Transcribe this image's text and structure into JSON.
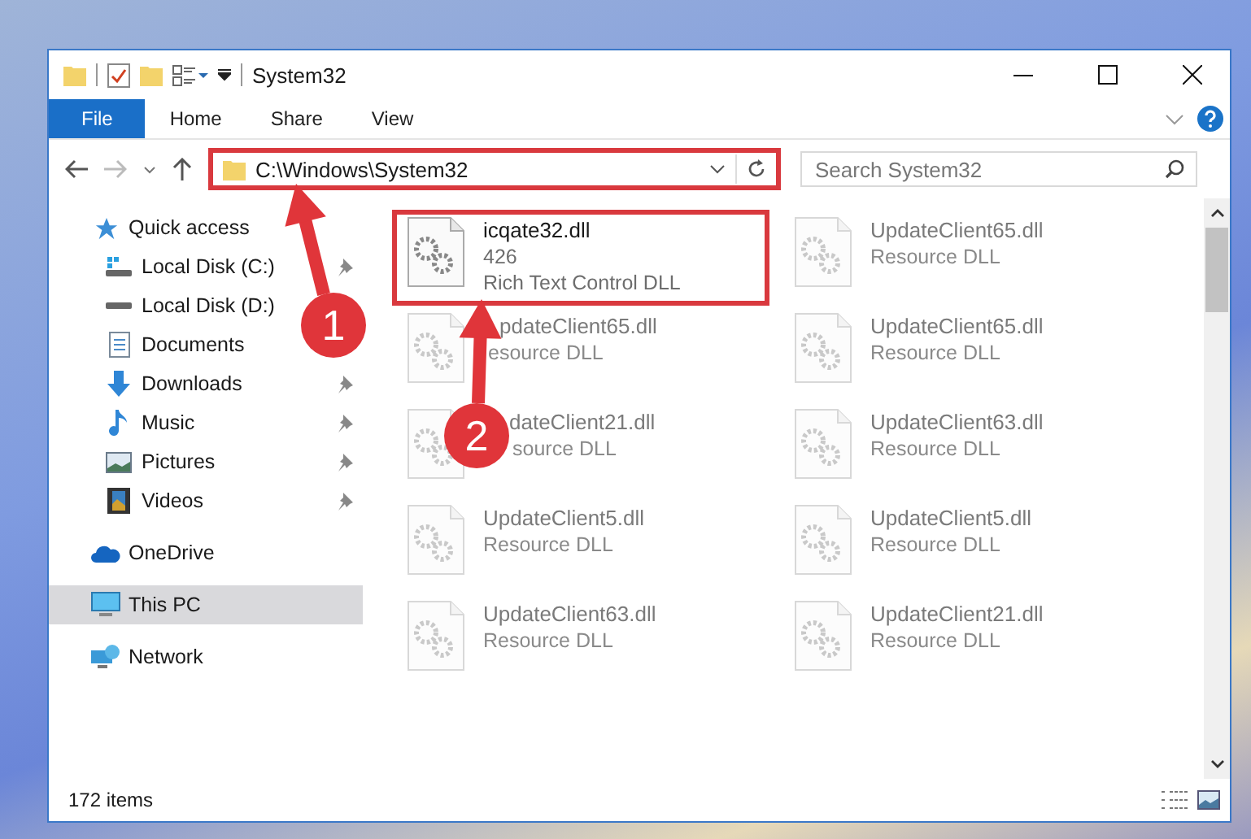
{
  "window": {
    "title": "System32"
  },
  "ribbon_tabs": [
    {
      "label": "File",
      "kind": "file"
    },
    {
      "label": "Home",
      "kind": "tab"
    },
    {
      "label": "Share",
      "kind": "tab"
    },
    {
      "label": "View",
      "kind": "tab"
    }
  ],
  "address_bar": {
    "path": "C:\\Windows\\System32",
    "highlighted": true
  },
  "search": {
    "placeholder": "Search System32"
  },
  "nav_pane": [
    {
      "label": "Quick access",
      "kind": "star",
      "selected": false,
      "children": [
        {
          "label": "Local Disk (C:)",
          "kind": "system-drive",
          "pinned": true,
          "selected": false
        },
        {
          "label": "Local Disk (D:)",
          "kind": "drive",
          "selected": false
        },
        {
          "label": "Documents",
          "kind": "documents",
          "selected": false
        },
        {
          "label": "Downloads",
          "kind": "downloads",
          "pinned": true,
          "selected": false
        },
        {
          "label": "Music",
          "kind": "music",
          "pinned": true,
          "selected": false
        },
        {
          "label": "Pictures",
          "kind": "pictures",
          "pinned": true,
          "selected": false
        },
        {
          "label": "Videos",
          "kind": "videos",
          "pinned": true,
          "selected": false
        }
      ]
    },
    {
      "label": "OneDrive",
      "kind": "cloud",
      "selected": false
    },
    {
      "label": "This PC",
      "kind": "computer",
      "selected": true
    },
    {
      "label": "Network",
      "kind": "network",
      "selected": false
    }
  ],
  "files": [
    {
      "name": "icqate32.dll",
      "details": [
        "426",
        "Rich Text Control DLL"
      ],
      "highlighted": true,
      "faded": false
    },
    {
      "name": "UpdateClient65.dll",
      "details": [
        "Resource DLL"
      ],
      "highlighted": false,
      "faded": true
    },
    {
      "name": "pdateClient65.dll",
      "details": [
        "esource DLL"
      ],
      "highlighted": false,
      "faded": true
    },
    {
      "name": "UpdateClient65.dll",
      "details": [
        "Resource DLL"
      ],
      "highlighted": false,
      "faded": true
    },
    {
      "name": "dateClient21.dll",
      "details": [
        "source DLL"
      ],
      "highlighted": false,
      "faded": true
    },
    {
      "name": "UpdateClient63.dll",
      "details": [
        "Resource DLL"
      ],
      "highlighted": false,
      "faded": true
    },
    {
      "name": "UpdateClient5.dll",
      "details": [
        "Resource DLL"
      ],
      "highlighted": false,
      "faded": true
    },
    {
      "name": "UpdateClient5.dll",
      "details": [
        "Resource DLL"
      ],
      "highlighted": false,
      "faded": true
    },
    {
      "name": "UpdateClient63.dll",
      "details": [
        "Resource DLL"
      ],
      "highlighted": false,
      "faded": true
    },
    {
      "name": "UpdateClient21.dll",
      "details": [
        "Resource DLL"
      ],
      "highlighted": false,
      "faded": true
    }
  ],
  "status_bar": {
    "item_count": "172 items"
  },
  "callouts": [
    {
      "label": "1"
    },
    {
      "label": "2"
    }
  ]
}
